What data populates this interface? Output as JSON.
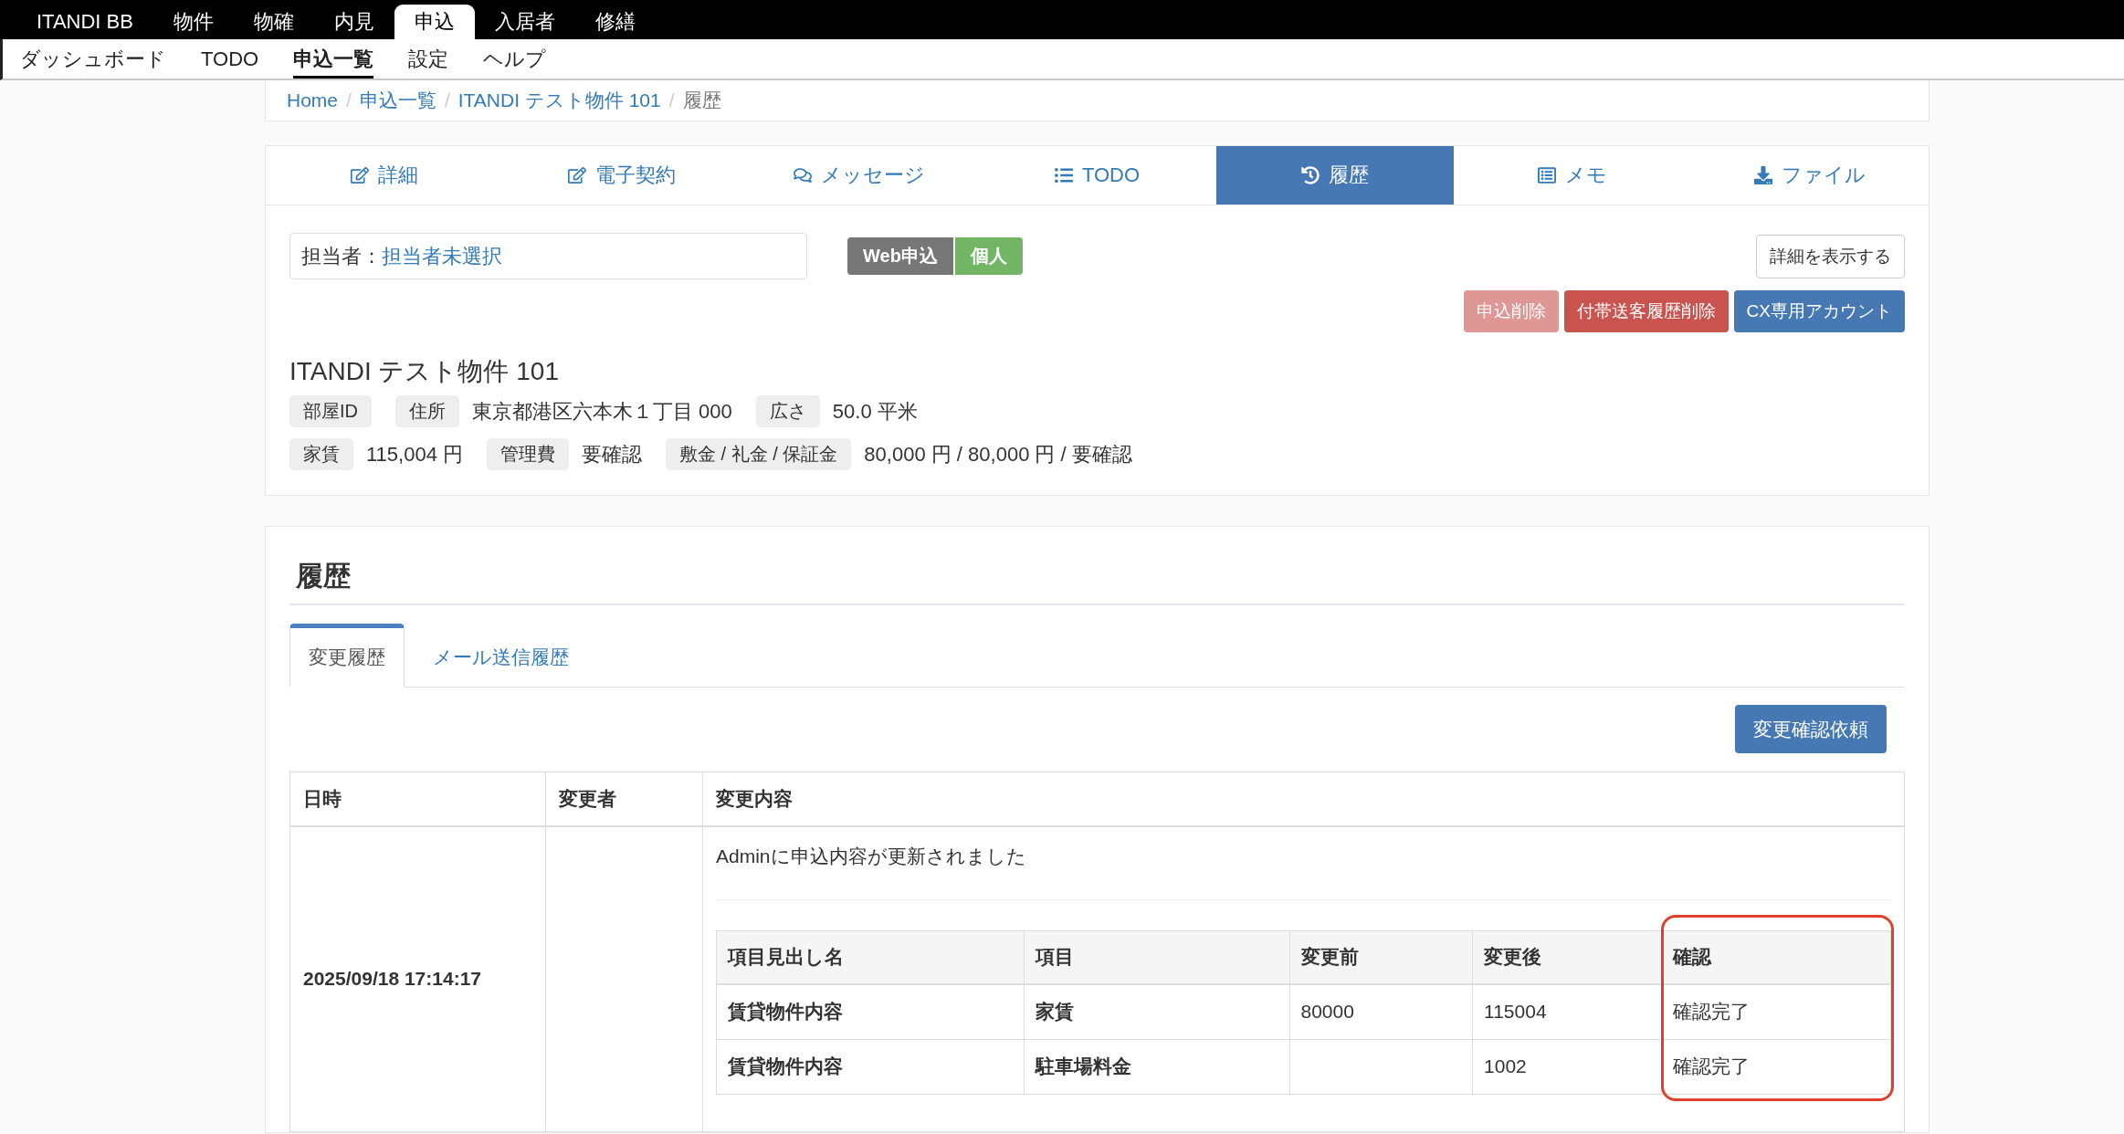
{
  "top_nav": {
    "brand": "ITANDI BB",
    "items": [
      {
        "label": "物件",
        "selected": false
      },
      {
        "label": "物確",
        "selected": false
      },
      {
        "label": "内見",
        "selected": false
      },
      {
        "label": "申込",
        "selected": true
      },
      {
        "label": "入居者",
        "selected": false
      },
      {
        "label": "修繕",
        "selected": false
      }
    ]
  },
  "sub_nav": {
    "items": [
      {
        "label": "ダッシュボード",
        "selected": false
      },
      {
        "label": "TODO",
        "selected": false
      },
      {
        "label": "申込一覧",
        "selected": true
      },
      {
        "label": "設定",
        "selected": false
      },
      {
        "label": "ヘルプ",
        "selected": false
      }
    ]
  },
  "breadcrumb": [
    {
      "label": "Home",
      "kind": "link",
      "separator": "/"
    },
    {
      "label": "申込一覧",
      "kind": "link",
      "separator": "/"
    },
    {
      "label": "ITANDI テスト物件 101",
      "kind": "link",
      "separator": "/"
    },
    {
      "label": "履歴",
      "kind": "current"
    }
  ],
  "tabs": [
    {
      "label": "詳細",
      "selected": false
    },
    {
      "label": "電子契約",
      "selected": false
    },
    {
      "label": "メッセージ",
      "selected": false
    },
    {
      "label": "TODO",
      "selected": false
    },
    {
      "label": "履歴",
      "selected": true
    },
    {
      "label": "メモ",
      "selected": false
    },
    {
      "label": "ファイル",
      "selected": false
    }
  ],
  "assignee": {
    "label": "担当者：",
    "value": "担当者未選択"
  },
  "badges": [
    {
      "label": "Web申込",
      "color": "#777777"
    },
    {
      "label": "個人",
      "color": "#72b564"
    }
  ],
  "details_button": "詳細を表示する",
  "actions": [
    {
      "label": "申込削除",
      "kind": "danger",
      "disabled": true
    },
    {
      "label": "付帯送客履歴削除",
      "kind": "danger",
      "disabled": false
    },
    {
      "label": "CX専用アカウント",
      "kind": "primary",
      "disabled": false
    }
  ],
  "property": {
    "title": "ITANDI テスト物件 101",
    "rows": [
      [
        {
          "label": "部屋ID"
        },
        {
          "label": "住所",
          "value": "東京都港区六本木１丁目 000"
        },
        {
          "label": "広さ",
          "value": "50.0 平米"
        }
      ],
      [
        {
          "label": "家賃",
          "value": "115,004 円"
        },
        {
          "label": "管理費",
          "value": "要確認"
        },
        {
          "label": "敷金 / 礼金 / 保証金",
          "value": "80,000 円 / 80,000 円 / 要確認"
        }
      ]
    ]
  },
  "history": {
    "title": "履歴",
    "tabs": [
      {
        "label": "変更履歴",
        "selected": true
      },
      {
        "label": "メール送信履歴",
        "selected": false
      }
    ],
    "request_button": "変更確認依頼",
    "table": {
      "columns": [
        "日時",
        "変更者",
        "変更内容"
      ],
      "rows": [
        {
          "datetime": "2025/09/18 17:14:17",
          "message": "Adminに申込内容が更新されました",
          "changes": {
            "columns": [
              {
                "label": "項目見出し名",
                "highlighted": false
              },
              {
                "label": "項目",
                "highlighted": false
              },
              {
                "label": "変更前",
                "highlighted": false
              },
              {
                "label": "変更後",
                "highlighted": false
              },
              {
                "label": "確認",
                "highlighted": true
              }
            ],
            "rows": [
              {
                "section": "賃貸物件内容",
                "item": "家賃",
                "before": "80000",
                "after": "115004",
                "status": "確認完了"
              },
              {
                "section": "賃貸物件内容",
                "item": "駐車場料金",
                "after": "1002",
                "status": "確認完了"
              }
            ]
          }
        }
      ]
    }
  }
}
